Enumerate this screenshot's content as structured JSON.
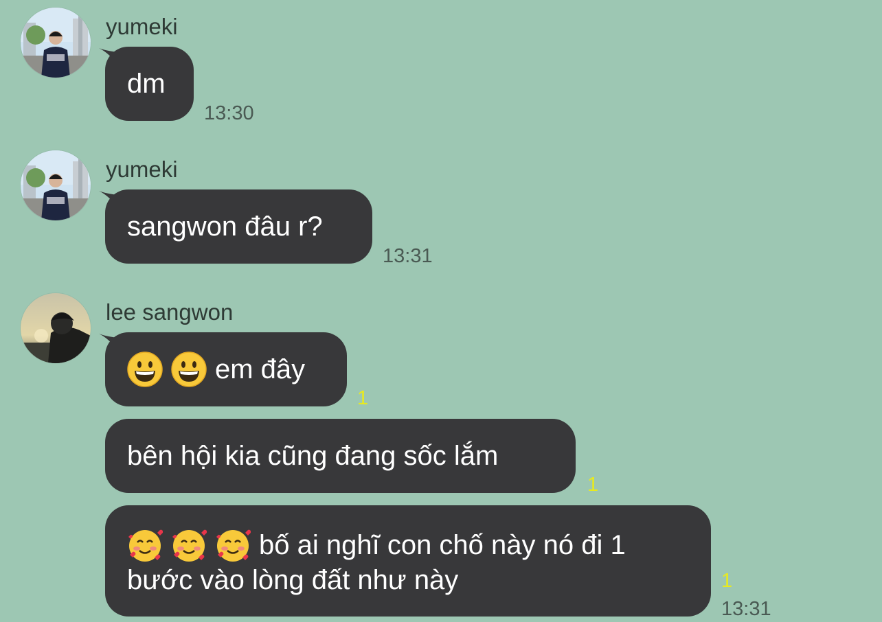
{
  "messages": [
    {
      "sender": "yumeki",
      "text": "dm",
      "time": "13:30"
    },
    {
      "sender": "yumeki",
      "text": "sangwon đâu r?",
      "time": "13:31"
    },
    {
      "sender": "lee sangwon",
      "text": "em đây",
      "emoji": "grinning-face",
      "unread": "1"
    },
    {
      "text": "bên hội kia cũng đang sốc lắm",
      "unread": "1"
    },
    {
      "text_line1": "bố ai nghĩ con chố này nó đi 1",
      "text_line2": "bước vào lòng đất như này",
      "emoji": "smiling-face-with-hearts",
      "unread": "1",
      "time": "13:31"
    }
  ],
  "colors": {
    "background": "#9dc7b3",
    "bubble": "#38383a",
    "unread": "#e8ea1f"
  }
}
